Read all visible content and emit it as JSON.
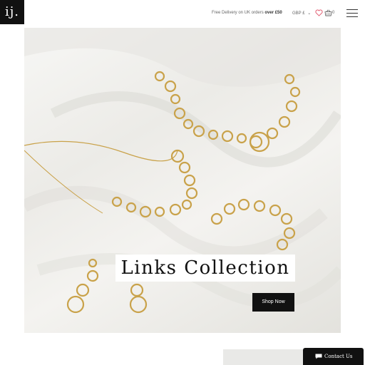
{
  "header": {
    "logo_text": "ij.",
    "promo_prefix": "Free Delivery on UK orders",
    "promo_bold": "over £50",
    "currency": "GBP £",
    "basket_count": "0"
  },
  "hero": {
    "title": "Links Collection",
    "button_label": "Shop Now"
  },
  "contact": {
    "label": "Contact Us"
  },
  "icons": {
    "logo": "brand-logo",
    "currency_chevron": "chevron-down-icon",
    "wishlist": "heart-icon",
    "basket": "basket-icon",
    "menu": "hamburger-menu-icon",
    "contact": "chat-icon"
  },
  "colors": {
    "accent": "#111111",
    "gold": "#c9a24a",
    "heart": "#e0556b"
  }
}
